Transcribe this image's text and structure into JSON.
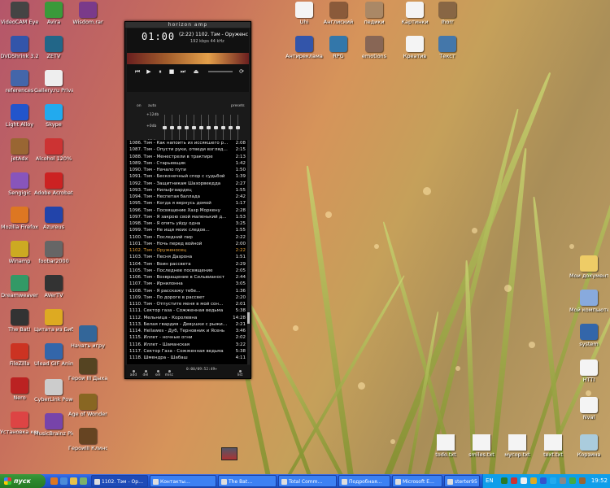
{
  "desktop_icons_left": [
    {
      "label": "VideoCAM Eye",
      "icon": "camera-icon",
      "color": "#444"
    },
    {
      "label": "Avira",
      "icon": "avira-icon",
      "color": "#3a9a3a"
    },
    {
      "label": "Wisdom.rar",
      "icon": "rar-icon",
      "color": "#7a3a8a"
    },
    {
      "label": "DVDShrink 3.2",
      "icon": "dvd-icon",
      "color": "#3355aa"
    },
    {
      "label": "ZETV",
      "icon": "tv-icon",
      "color": "#226688"
    },
    {
      "label": "references",
      "icon": "doc-icon",
      "color": "#4466aa"
    },
    {
      "label": "Gallery.ru Private Gallery",
      "icon": "gallery-icon",
      "color": "#eeeeee"
    },
    {
      "label": "Light Alloy",
      "icon": "player-icon",
      "color": "#2255cc"
    },
    {
      "label": "Skype",
      "icon": "skype-icon",
      "color": "#22aaee"
    },
    {
      "label": "jetAdx",
      "icon": "app-icon",
      "color": "#996633"
    },
    {
      "label": "Alcohol 120%",
      "icon": "alcohol-icon",
      "color": "#cc3333"
    },
    {
      "label": "Sengigic",
      "icon": "app-icon",
      "color": "#8855bb"
    },
    {
      "label": "Adobe Acrobat…",
      "icon": "acrobat-icon",
      "color": "#cc2222"
    },
    {
      "label": "Mozilla Firefox",
      "icon": "firefox-icon",
      "color": "#dd7722"
    },
    {
      "label": "Azureus",
      "icon": "azureus-icon",
      "color": "#2244aa"
    },
    {
      "label": "Winamp",
      "icon": "winamp-icon",
      "color": "#ccaa22"
    },
    {
      "label": "foobar2000",
      "icon": "foobar-icon",
      "color": "#666666"
    },
    {
      "label": "Dreamweaver",
      "icon": "dreamweaver-icon",
      "color": "#339966"
    },
    {
      "label": "AVerTV",
      "icon": "tv-icon",
      "color": "#333333"
    },
    {
      "label": "The Bat!",
      "icon": "bat-icon",
      "color": "#333333"
    },
    {
      "label": "Цитата из Библии",
      "icon": "quote-icon",
      "color": "#ddaa22"
    },
    {
      "label": "Начать игру",
      "icon": "game-icon",
      "color": "#336699"
    },
    {
      "label": "FileZilla",
      "icon": "filezilla-icon",
      "color": "#cc3322"
    },
    {
      "label": "Ulead GIF Animator 5",
      "icon": "ulead-icon",
      "color": "#3366aa"
    },
    {
      "label": "Герои III Дыхан…",
      "icon": "heroes-icon",
      "color": "#554422"
    },
    {
      "label": "Nero",
      "icon": "nero-icon",
      "color": "#bb2222"
    },
    {
      "label": "CyberLink PowerDVD",
      "icon": "dvd-icon",
      "color": "#cccccc"
    },
    {
      "label": "Age of Wonders II",
      "icon": "aow-icon",
      "color": "#886622"
    },
    {
      "label": "Установка компонента",
      "icon": "setup-icon",
      "color": "#dd4444"
    },
    {
      "label": "MusicBrainz Picard",
      "icon": "picard-icon",
      "color": "#7744aa"
    },
    {
      "label": "ГероиIII Клинок Ар…",
      "icon": "heroes-icon",
      "color": "#664422"
    }
  ],
  "desktop_icons_top": [
    {
      "label": "Uhi",
      "icon": "doc-icon",
      "color": "#f4f4f4"
    },
    {
      "label": "Англиский",
      "icon": "eagle-icon",
      "color": "#8a5a3a"
    },
    {
      "label": "педики",
      "icon": "mushroom-icon",
      "color": "#aa8866"
    },
    {
      "label": "Картинки",
      "icon": "pictures-icon",
      "color": "#f4f4f4"
    },
    {
      "label": "Ihorr",
      "icon": "photo-icon",
      "color": "#886644"
    },
    {
      "label": "Антиреклама",
      "icon": "doc-icon",
      "color": "#3355aa"
    },
    {
      "label": "RPG",
      "icon": "rpg-icon",
      "color": "#3377aa"
    },
    {
      "label": "emotions",
      "icon": "emotions-icon",
      "color": "#886655"
    },
    {
      "label": "Креатив",
      "icon": "doc-icon",
      "color": "#f4f4f4"
    },
    {
      "label": "Текст",
      "icon": "doc-icon",
      "color": "#4477aa"
    }
  ],
  "desktop_icons_right": [
    {
      "label": "Мои документы",
      "icon": "documents-icon",
      "color": "#eecc66"
    },
    {
      "label": "Мой компьютер",
      "icon": "computer-icon",
      "color": "#88aadd"
    },
    {
      "label": "system",
      "icon": "folder-icon",
      "color": "#3366aa"
    },
    {
      "label": "HTTI",
      "icon": "doc-icon",
      "color": "#f4f4f4"
    },
    {
      "label": "Nval",
      "icon": "doc-icon",
      "color": "#f4f4f4"
    },
    {
      "label": "Корзина",
      "icon": "recycle-bin-icon",
      "color": "#aaccdd"
    }
  ],
  "desktop_files_bottom": [
    {
      "label": "todo.txt",
      "icon": "text-file-icon"
    },
    {
      "label": "smiles.txt",
      "icon": "text-file-icon"
    },
    {
      "label": "мусор.txt",
      "icon": "text-file-icon"
    },
    {
      "label": "text.txt",
      "icon": "text-file-icon"
    }
  ],
  "winamp": {
    "title": "horizon amp",
    "time": "01:00",
    "track_display": "(2:22) 1102. Тэм - Оруженс",
    "kbps": "192 kbps",
    "khz": "44 kHz",
    "eq_on": "on",
    "eq_auto": "auto",
    "eq_presets": "presets",
    "eq_plus": "+12db",
    "eq_zero": "+0db",
    "eq_minus": "-12db",
    "eq_levels": [
      0.5,
      0.5,
      0.5,
      0.5,
      0.5,
      0.5,
      0.5,
      0.5,
      0.5,
      0.5,
      0.5
    ],
    "playlist_time": "0:00/09:52:49+",
    "bottom_buttons": [
      "add",
      "del",
      "sel",
      "misc",
      "list"
    ]
  },
  "playlist": [
    {
      "title": "1086. Тэм - Как напоить из иссякшего р…",
      "dur": "2:08"
    },
    {
      "title": "1087. Тэм - Опусти руки, отведи взгляд…",
      "dur": "2:15"
    },
    {
      "title": "1088. Тэм - Менестрели в трактире",
      "dur": "2:13"
    },
    {
      "title": "1089. Тэм - Старьевщик",
      "dur": "1:42"
    },
    {
      "title": "1090. Тэм - Начало пути",
      "dur": "1:50"
    },
    {
      "title": "1091. Тэм - Бесконечный спор с судьбой",
      "dur": "1:39"
    },
    {
      "title": "1092. Тэм - Защитникам Шазорвеедда",
      "dur": "2:27"
    },
    {
      "title": "1093. Тэм - Нильфгаардец",
      "dur": "1:55"
    },
    {
      "title": "1094. Тэм - Неспетая баллада",
      "dur": "2:42"
    },
    {
      "title": "1095. Тэм - Когда я вернусь домой",
      "dur": "1:17"
    },
    {
      "title": "1096. Тэм - Посвящение Хазр Моркену",
      "dur": "2:28"
    },
    {
      "title": "1097. Тэм - Я закрою свой маленький д…",
      "dur": "1:53"
    },
    {
      "title": "1098. Тэм - Я опять уйду одна",
      "dur": "3:25"
    },
    {
      "title": "1099. Тэм - Не ищи моих следов…",
      "dur": "1:55"
    },
    {
      "title": "1100. Тэм - Последний пир",
      "dur": "2:22"
    },
    {
      "title": "1101. Тэм - Ночь перед войной",
      "dur": "2:00"
    },
    {
      "title": "1102. Тэм - Оруженосец",
      "dur": "2:22",
      "current": true
    },
    {
      "title": "1103. Тэм - Песня Дазрона",
      "dur": "1:51"
    },
    {
      "title": "1104. Тэм - Воин рассвета",
      "dur": "2:29"
    },
    {
      "title": "1105. Тэм - Последнее посвящение",
      "dur": "2:05"
    },
    {
      "title": "1106. Тэм - Возвращение в Сильвианост",
      "dur": "2:44"
    },
    {
      "title": "1107. Тэм - Ирнилонна",
      "dur": "3:05"
    },
    {
      "title": "1108. Тэм - Я расскажу тебе…",
      "dur": "1:36"
    },
    {
      "title": "1109. Тэм - По дороге в рассвет",
      "dur": "2:20"
    },
    {
      "title": "1110. Тэм - Отпустите меня в мой сон…",
      "dur": "2:01"
    },
    {
      "title": "1111. Сектор газа - Сожженная ведьма",
      "dur": "5:38"
    },
    {
      "title": "1112. Мельница - Королевна",
      "dur": "14:28"
    },
    {
      "title": "1113. Белая гвардия - Девушки с рыжи…",
      "dur": "2:21"
    },
    {
      "title": "1114. Hellawes - Дуб, Терновник и Ясень",
      "dur": "3:46"
    },
    {
      "title": "1115. Иллет - ночные огни",
      "dur": "2:02"
    },
    {
      "title": "1116. Иллет - Шаманская",
      "dur": "3:22"
    },
    {
      "title": "1117. Сектор Газа - Сожженная ведьма",
      "dur": "5:38"
    },
    {
      "title": "1118. Шмендра - Шабаш",
      "dur": "4:11"
    }
  ],
  "taskbar": {
    "start_label": "пуск",
    "tasks": [
      {
        "label": "1102. Тэм - Ор…",
        "active": true
      },
      {
        "label": "Контакты…"
      },
      {
        "label": "The Bat…"
      },
      {
        "label": "Total Comm…"
      },
      {
        "label": "Подробная…"
      },
      {
        "label": "Microsoft E…"
      },
      {
        "label": "sterter95 (2…"
      }
    ],
    "lang": "EN",
    "clock": "19:52"
  }
}
